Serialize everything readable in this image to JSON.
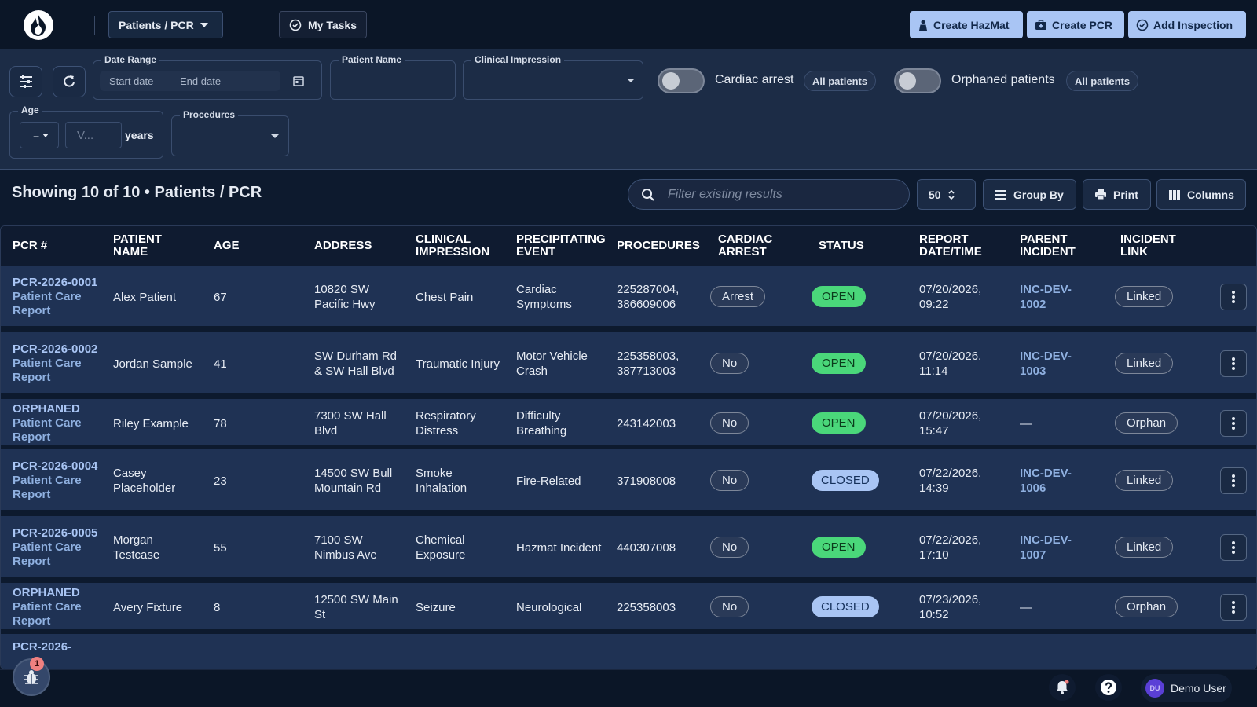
{
  "topbar": {
    "patients_menu_label": "Patients / PCR",
    "my_tasks_label": "My Tasks",
    "create_hazmat_label": "Create HazMat",
    "create_pcr_label": "Create PCR",
    "add_inspection_label": "Add Inspection"
  },
  "filters": {
    "date_range_label": "Date Range",
    "start_date_placeholder": "Start date",
    "end_date_placeholder": "End date",
    "patient_name_label": "Patient Name",
    "clinical_impression_label": "Clinical Impression",
    "cardiac_arrest_label": "Cardiac arrest",
    "cardiac_arrest_chip": "All patients",
    "orphaned_label": "Orphaned patients",
    "orphaned_chip": "All patients",
    "age_label": "Age",
    "age_operator": "=",
    "age_value_placeholder": "V...",
    "age_unit": "years",
    "procedures_label": "Procedures"
  },
  "results": {
    "title": "Showing 10 of 10 • Patients / PCR",
    "search_placeholder": "Filter existing results",
    "page_size": "50",
    "group_by_label": "Group By",
    "print_label": "Print",
    "columns_label": "Columns"
  },
  "table": {
    "headers": [
      "PCR #",
      "PATIENT NAME",
      "AGE",
      "ADDRESS",
      "CLINICAL IMPRESSION",
      "PRECIPITATING EVENT",
      "PROCEDURES",
      "CARDIAC ARREST",
      "STATUS",
      "REPORT DATE/TIME",
      "PARENT INCIDENT",
      "INCIDENT LINK"
    ],
    "rows": [
      {
        "pcr_id": "PCR-2026-0001",
        "pcr_type": "Patient Care Report",
        "patient": "Alex Patient",
        "age": "67",
        "address": "10820 SW Pacific Hwy",
        "impression": "Chest Pain",
        "event": "Cardiac Symptoms",
        "procedures": "225287004, 386609006",
        "cardiac": "Arrest",
        "status": "OPEN",
        "datetime": "07/20/2026, 09:22",
        "parent": "INC-DEV-1002",
        "link": "Linked"
      },
      {
        "pcr_id": "PCR-2026-0002",
        "pcr_type": "Patient Care Report",
        "patient": "Jordan Sample",
        "age": "41",
        "address": "SW Durham Rd & SW Hall Blvd",
        "impression": "Traumatic Injury",
        "event": "Motor Vehicle Crash",
        "procedures": "225358003, 387713003",
        "cardiac": "No",
        "status": "OPEN",
        "datetime": "07/20/2026, 11:14",
        "parent": "INC-DEV-1003",
        "link": "Linked"
      },
      {
        "pcr_id": "ORPHANED",
        "pcr_type": "Patient Care Report",
        "patient": "Riley Example",
        "age": "78",
        "address": "7300 SW Hall Blvd",
        "impression": "Respiratory Distress",
        "event": "Difficulty Breathing",
        "procedures": "243142003",
        "cardiac": "No",
        "status": "OPEN",
        "datetime": "07/20/2026, 15:47",
        "parent": "—",
        "link": "Orphan"
      },
      {
        "pcr_id": "PCR-2026-0004",
        "pcr_type": "Patient Care Report",
        "patient": "Casey Placeholder",
        "age": "23",
        "address": "14500 SW Bull Mountain Rd",
        "impression": "Smoke Inhalation",
        "event": "Fire-Related",
        "procedures": "371908008",
        "cardiac": "No",
        "status": "CLOSED",
        "datetime": "07/22/2026, 14:39",
        "parent": "INC-DEV-1006",
        "link": "Linked"
      },
      {
        "pcr_id": "PCR-2026-0005",
        "pcr_type": "Patient Care Report",
        "patient": "Morgan Testcase",
        "age": "55",
        "address": "7100 SW Nimbus Ave",
        "impression": "Chemical Exposure",
        "event": "Hazmat Incident",
        "procedures": "440307008",
        "cardiac": "No",
        "status": "OPEN",
        "datetime": "07/22/2026, 17:10",
        "parent": "INC-DEV-1007",
        "link": "Linked"
      },
      {
        "pcr_id": "ORPHANED",
        "pcr_type": "Patient Care Report",
        "patient": "Avery Fixture",
        "age": "8",
        "address": "12500 SW Main St",
        "impression": "Seizure",
        "event": "Neurological",
        "procedures": "225358003",
        "cardiac": "No",
        "status": "CLOSED",
        "datetime": "07/23/2026, 10:52",
        "parent": "—",
        "link": "Orphan"
      }
    ],
    "partial_row_text": "PCR-2026-"
  },
  "bottombar": {
    "badge_count": "1",
    "user_initials": "DU",
    "user_name": "Demo User"
  },
  "colors": {
    "accent": "#a9c5f4",
    "open_status": "#4ad77a",
    "closed_status": "#a9c5f4",
    "row_bg": "#1f3254",
    "page_bg": "#0d1a2e"
  },
  "icons": {
    "logo": "flame-logo-icon",
    "tasks": "check-circle-icon",
    "hazmat": "hazmat-suit-icon",
    "pcr": "medical-kit-icon",
    "inspection": "clipboard-check-icon",
    "filter": "sliders-icon",
    "reset": "refresh-icon",
    "calendar": "calendar-icon",
    "search": "search-icon",
    "group": "list-icon",
    "print": "printer-icon",
    "columns": "columns-icon",
    "row_menu": "kebab-icon",
    "bug": "bug-icon",
    "bell": "bell-icon",
    "help": "help-icon"
  }
}
